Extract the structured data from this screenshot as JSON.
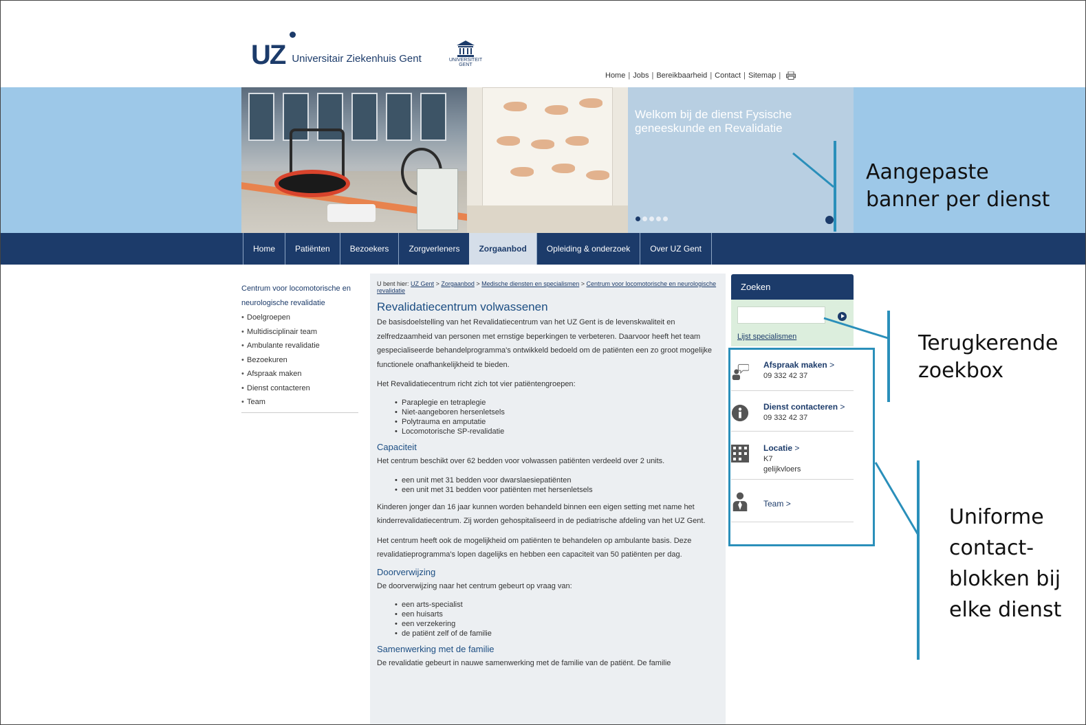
{
  "header": {
    "logo_text": "UZ",
    "hospital_name": "Universitair Ziekenhuis Gent",
    "university_logo_text": "UNIVERSITEIT GENT",
    "top_links": [
      "Home",
      "Jobs",
      "Bereikbaarheid",
      "Contact",
      "Sitemap"
    ]
  },
  "banner": {
    "title": "Welkom bij de dienst Fysische geneeskunde en Revalidatie",
    "slide_count": 5,
    "active_slide": 1
  },
  "nav": {
    "items": [
      "Home",
      "Patiënten",
      "Bezoekers",
      "Zorgverleners",
      "Zorgaanbod",
      "Opleiding & onderzoek",
      "Over UZ Gent"
    ],
    "active": "Zorgaanbod"
  },
  "sidebar": {
    "title": "Centrum voor locomotorische en neurologische revalidatie",
    "items": [
      "Doelgroepen",
      "Multidisciplinair team",
      "Ambulante revalidatie",
      "Bezoekuren",
      "Afspraak maken",
      "Dienst contacteren",
      "Team"
    ]
  },
  "breadcrumb": {
    "prefix": "U bent hier:",
    "items": [
      "UZ Gent",
      "Zorgaanbod",
      "Medische diensten en specialismen",
      "Centrum voor locomotorische en neurologische revalidatie"
    ]
  },
  "content": {
    "title": "Revalidatiecentrum volwassenen",
    "intro": "De basisdoelstelling van het Revalidatiecentrum van het UZ Gent is de levenskwaliteit en zelfredzaamheid van personen met ernstige beperkingen te verbeteren. Daarvoor heeft het team gespecialiseerde behandelprogramma's ontwikkeld bedoeld om de patiënten een zo groot mogelijke functionele onafhankelijkheid te bieden.",
    "groups_intro_before": "Het Revalidatiecentrum richt zich tot vier ",
    "groups_link": "patiëntengroepen",
    "groups_intro_after": ":",
    "groups": [
      "Paraplegie en tetraplegie",
      "Niet-aangeboren hersenletsels",
      "Polytrauma en amputatie",
      "Locomotorische SP-revalidatie"
    ],
    "capacity_heading": "Capaciteit",
    "capacity_text": "Het centrum beschikt over 62 bedden voor volwassen patiënten verdeeld over 2 units.",
    "units": [
      "een unit met 31 bedden voor dwarslaesiepatiënten",
      "een unit met 31 bedden voor patiënten met hersenletsels"
    ],
    "children_text": "Kinderen jonger dan 16 jaar kunnen worden behandeld binnen een eigen setting met name het kinderrevalidatiecentrum. Zij worden gehospitaliseerd in de pediatrische afdeling van het UZ Gent.",
    "ambulant_text": "Het centrum heeft ook de mogelijkheid om patiënten te behandelen op ambulante basis. Deze revalidatieprogramma's lopen dagelijks en hebben een capaciteit van 50 patiënten per dag.",
    "referral_heading": "Doorverwijzing",
    "referral_text": "De doorverwijzing naar het centrum gebeurt op vraag van:",
    "referrers": [
      "een arts-specialist",
      "een huisarts",
      "een verzekering",
      "de patiënt zelf of de familie"
    ],
    "family_heading": "Samenwerking met de familie",
    "family_text": "De revalidatie gebeurt in nauwe samenwerking met de familie van de patiënt. De familie"
  },
  "search": {
    "heading": "Zoeken",
    "placeholder": "",
    "link": "Lijst specialismen"
  },
  "contact_blocks": [
    {
      "title": "Afspraak maken",
      "arrow": ">",
      "lines": [
        "09 332 42 37"
      ],
      "icon": "appointment-icon"
    },
    {
      "title": "Dienst contacteren",
      "arrow": ">",
      "lines": [
        "09 332 42 37"
      ],
      "icon": "info-icon"
    },
    {
      "title": "Locatie",
      "arrow": ">",
      "lines": [
        "K7",
        "gelijkvloers"
      ],
      "icon": "building-icon"
    },
    {
      "title": "Team",
      "arrow": ">",
      "lines": [],
      "icon": "team-icon"
    }
  ],
  "annotations": {
    "banner": [
      "Aangepaste",
      "banner per dienst"
    ],
    "search": [
      "Terugkerende",
      "zoekbox"
    ],
    "contact": [
      "Uniforme",
      "contact-",
      "blokken bij",
      "elke dienst"
    ],
    "line_color": "#2a8fba"
  },
  "colors": {
    "brand": "#1c3b6a",
    "banner_band": "#9dc8e8",
    "content_bg": "#eceff2",
    "search_bg": "#dceedd"
  }
}
